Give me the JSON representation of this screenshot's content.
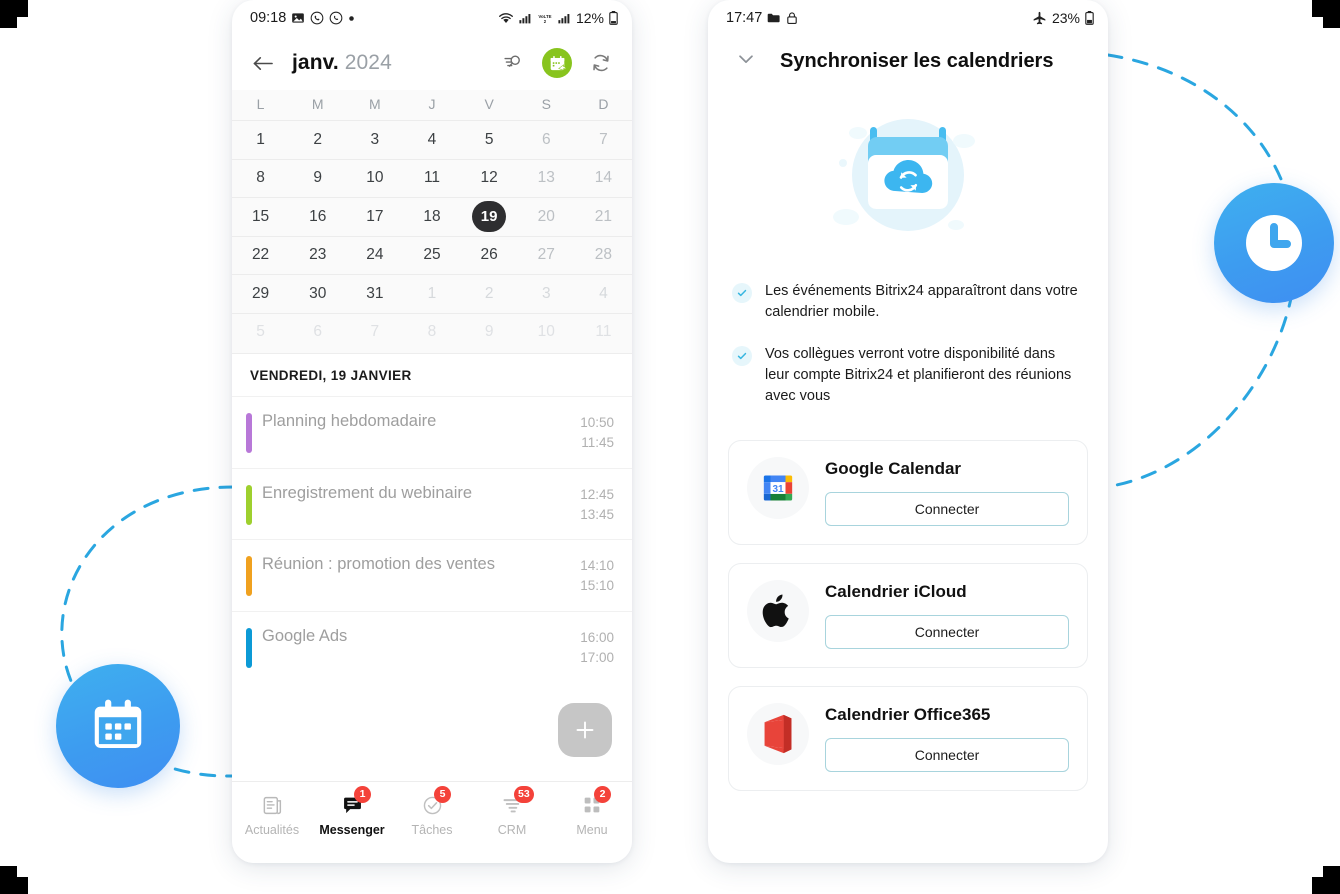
{
  "phone_left": {
    "statusbar": {
      "time": "09:18",
      "left_icons": [
        "image-icon",
        "whatsapp-icon",
        "viber-icon",
        "dot-icon"
      ],
      "right_icons": [
        "wifi-icon",
        "signal-icon",
        "volte-icon",
        "signal2-icon"
      ],
      "battery": "12%"
    },
    "header": {
      "back_icon": "arrow-left-icon",
      "month": "janv.",
      "year": "2024",
      "search_icon": "search-filter-icon",
      "add_icon": "calendar-share-icon",
      "sync_icon": "sync-icon",
      "accent_green": "#88c41e"
    },
    "calendar": {
      "dow": [
        "L",
        "M",
        "M",
        "J",
        "V",
        "S",
        "D"
      ],
      "selected_day": "19",
      "weeks": [
        [
          {
            "d": "1"
          },
          {
            "d": "2"
          },
          {
            "d": "3"
          },
          {
            "d": "4"
          },
          {
            "d": "5"
          },
          {
            "d": "6",
            "w": true
          },
          {
            "d": "7",
            "w": true
          }
        ],
        [
          {
            "d": "8"
          },
          {
            "d": "9"
          },
          {
            "d": "10"
          },
          {
            "d": "11"
          },
          {
            "d": "12"
          },
          {
            "d": "13",
            "w": true
          },
          {
            "d": "14",
            "w": true
          }
        ],
        [
          {
            "d": "15"
          },
          {
            "d": "16"
          },
          {
            "d": "17"
          },
          {
            "d": "18"
          },
          {
            "d": "19",
            "sel": true
          },
          {
            "d": "20",
            "w": true
          },
          {
            "d": "21",
            "w": true
          }
        ],
        [
          {
            "d": "22"
          },
          {
            "d": "23"
          },
          {
            "d": "24"
          },
          {
            "d": "25"
          },
          {
            "d": "26"
          },
          {
            "d": "27",
            "w": true
          },
          {
            "d": "28",
            "w": true
          }
        ],
        [
          {
            "d": "29"
          },
          {
            "d": "30"
          },
          {
            "d": "31"
          },
          {
            "d": "1",
            "o": true
          },
          {
            "d": "2",
            "o": true
          },
          {
            "d": "3",
            "o": true
          },
          {
            "d": "4",
            "o": true
          }
        ],
        [
          {
            "d": "5",
            "o": true
          },
          {
            "d": "6",
            "o": true
          },
          {
            "d": "7",
            "o": true
          },
          {
            "d": "8",
            "o": true
          },
          {
            "d": "9",
            "o": true
          },
          {
            "d": "10",
            "o": true
          },
          {
            "d": "11",
            "o": true
          }
        ]
      ]
    },
    "day_header": "VENDREDI, 19 JANVIER",
    "events": [
      {
        "title": "Planning hebdomadaire",
        "start": "10:50",
        "end": "11:45",
        "color": "#b878d8"
      },
      {
        "title": "Enregistrement du webinaire",
        "start": "12:45",
        "end": "13:45",
        "color": "#9ed02e"
      },
      {
        "title": "Réunion : promotion des ventes",
        "start": "14:10",
        "end": "15:10",
        "color": "#f0a11f"
      },
      {
        "title": "Google Ads",
        "start": "16:00",
        "end": "17:00",
        "color": "#0c9ad6"
      }
    ],
    "fab": {
      "icon": "plus-icon",
      "color": "#c6c6c6"
    },
    "bottom_nav": [
      {
        "label": "Actualités",
        "icon": "news-icon",
        "badge": "",
        "active": false
      },
      {
        "label": "Messenger",
        "icon": "chat-icon",
        "badge": "1",
        "active": true
      },
      {
        "label": "Tâches",
        "icon": "check-icon",
        "badge": "5",
        "active": false
      },
      {
        "label": "CRM",
        "icon": "funnel-icon",
        "badge": "53",
        "active": false
      },
      {
        "label": "Menu",
        "icon": "grid-icon",
        "badge": "2",
        "active": false
      }
    ]
  },
  "phone_right": {
    "statusbar": {
      "time": "17:47",
      "left_icons": [
        "folder-icon",
        "lock-icon"
      ],
      "right_icons": [
        "airplane-icon"
      ],
      "battery": "23%"
    },
    "header": {
      "collapse_icon": "chevron-down-icon",
      "title": "Synchroniser les calendriers"
    },
    "hero_icon": "calendar-cloud-sync-illustration",
    "bullets": [
      {
        "check_icon": "check-icon",
        "text": "Les événements Bitrix24 apparaîtront dans votre calendrier mobile."
      },
      {
        "check_icon": "check-icon",
        "text": "Vos collègues verront votre disponibilité dans leur compte Bitrix24 et planifieront des réunions avec vous"
      }
    ],
    "cards": [
      {
        "name": "Google Calendar",
        "logo": "google-calendar-icon",
        "button": "Connecter"
      },
      {
        "name": "Calendrier iCloud",
        "logo": "apple-icon",
        "button": "Connecter"
      },
      {
        "name": "Calendrier Office365",
        "logo": "office365-icon",
        "button": "Connecter"
      }
    ]
  },
  "decor": {
    "calendar_badge_icon": "calendar-icon",
    "clock_badge_icon": "clock-icon",
    "arc_color": "#2aa6e0",
    "badge_gradient_from": "#3fb0ef",
    "badge_gradient_to": "#3f8ef2"
  }
}
